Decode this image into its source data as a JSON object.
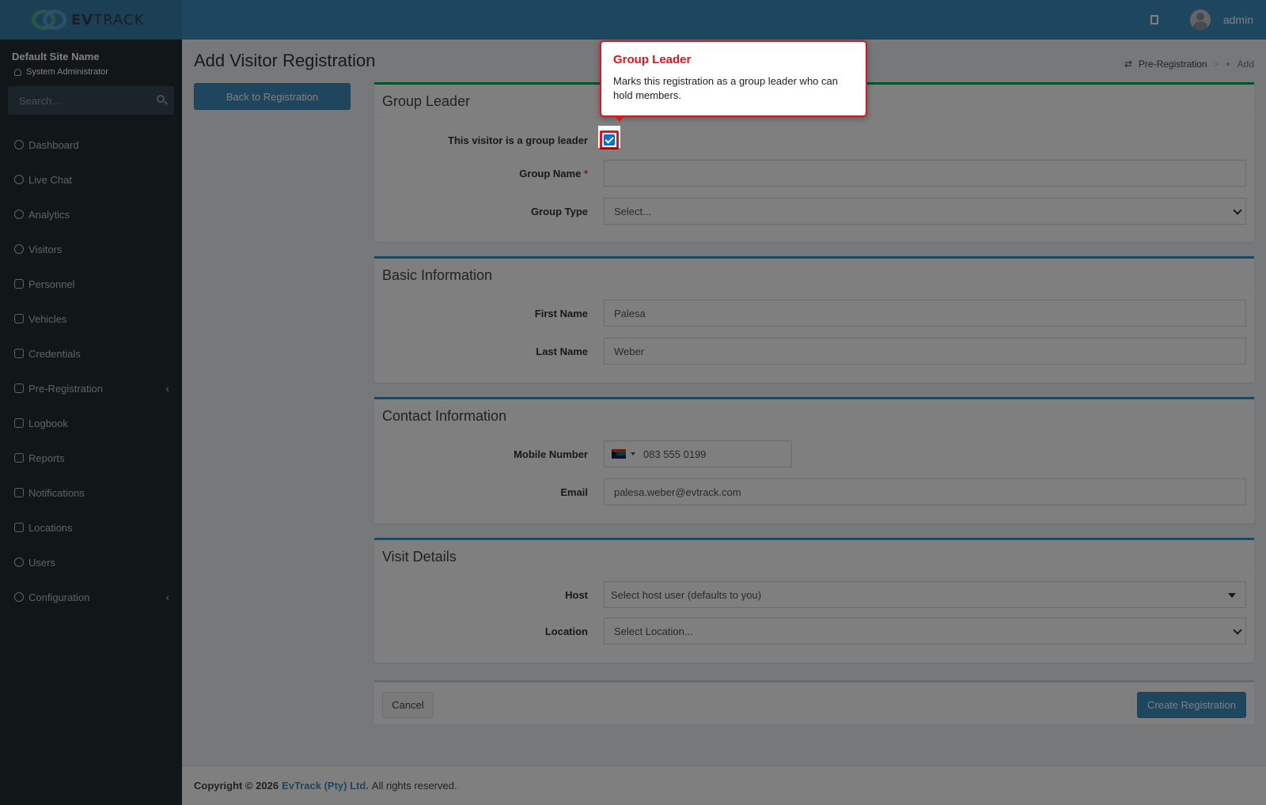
{
  "brand": {
    "logo_bold": "EV",
    "logo_rest": "TRACK"
  },
  "header": {
    "username": "admin"
  },
  "sidebar": {
    "site_name": "Default Site Name",
    "role": "System Administrator",
    "search_placeholder": "Search...",
    "items": [
      {
        "label": "Dashboard",
        "icon": "dashboard-icon"
      },
      {
        "label": "Live Chat",
        "icon": "headset-icon"
      },
      {
        "label": "Analytics",
        "icon": "target-icon"
      },
      {
        "label": "Visitors",
        "icon": "eye-icon"
      },
      {
        "label": "Personnel",
        "icon": "users-icon"
      },
      {
        "label": "Vehicles",
        "icon": "car-icon"
      },
      {
        "label": "Credentials",
        "icon": "id-card-icon"
      },
      {
        "label": "Pre-Registration",
        "icon": "exchange-icon"
      },
      {
        "label": "Logbook",
        "icon": "book-icon"
      },
      {
        "label": "Reports",
        "icon": "reports-icon"
      },
      {
        "label": "Notifications",
        "icon": "chat-icon"
      },
      {
        "label": "Locations",
        "icon": "map-icon"
      },
      {
        "label": "Users",
        "icon": "user-cog-icon"
      },
      {
        "label": "Configuration",
        "icon": "gear-icon"
      }
    ]
  },
  "page": {
    "title": "Add Visitor Registration",
    "breadcrumb": [
      "Pre-Registration",
      "Add"
    ],
    "back_button": "Back to Registration"
  },
  "group_leader": {
    "title": "Group Leader",
    "checkbox_label": "This visitor is a group leader",
    "checked": true,
    "group_name_label": "Group Name",
    "required_mark": "*",
    "group_name_value": "",
    "group_type_label": "Group Type",
    "group_type_value": "Select..."
  },
  "basic": {
    "title": "Basic Information",
    "first_name_label": "First Name",
    "first_name_value": "Palesa",
    "last_name_label": "Last Name",
    "last_name_value": "Weber"
  },
  "contact": {
    "title": "Contact Information",
    "mobile_label": "Mobile Number",
    "mobile_value": "083 555 0199",
    "email_label": "Email",
    "email_value": "palesa.weber@evtrack.com"
  },
  "visit": {
    "title": "Visit Details",
    "host_label": "Host",
    "host_value": "Select host user (defaults to you)",
    "location_label": "Location",
    "location_value": "Select Location..."
  },
  "actions": {
    "cancel": "Cancel",
    "create": "Create Registration"
  },
  "footer": {
    "prefix": "Copyright © 2026",
    "company": "EvTrack (Pty) Ltd.",
    "suffix": "All rights reserved."
  },
  "tooltip": {
    "title": "Group Leader",
    "text": "Marks this registration as a group leader who can hold members."
  },
  "colors": {
    "primary": "#3c8dbc",
    "sidebar": "#222d32",
    "highlight": "#e3121e",
    "success": "#00a65a"
  }
}
